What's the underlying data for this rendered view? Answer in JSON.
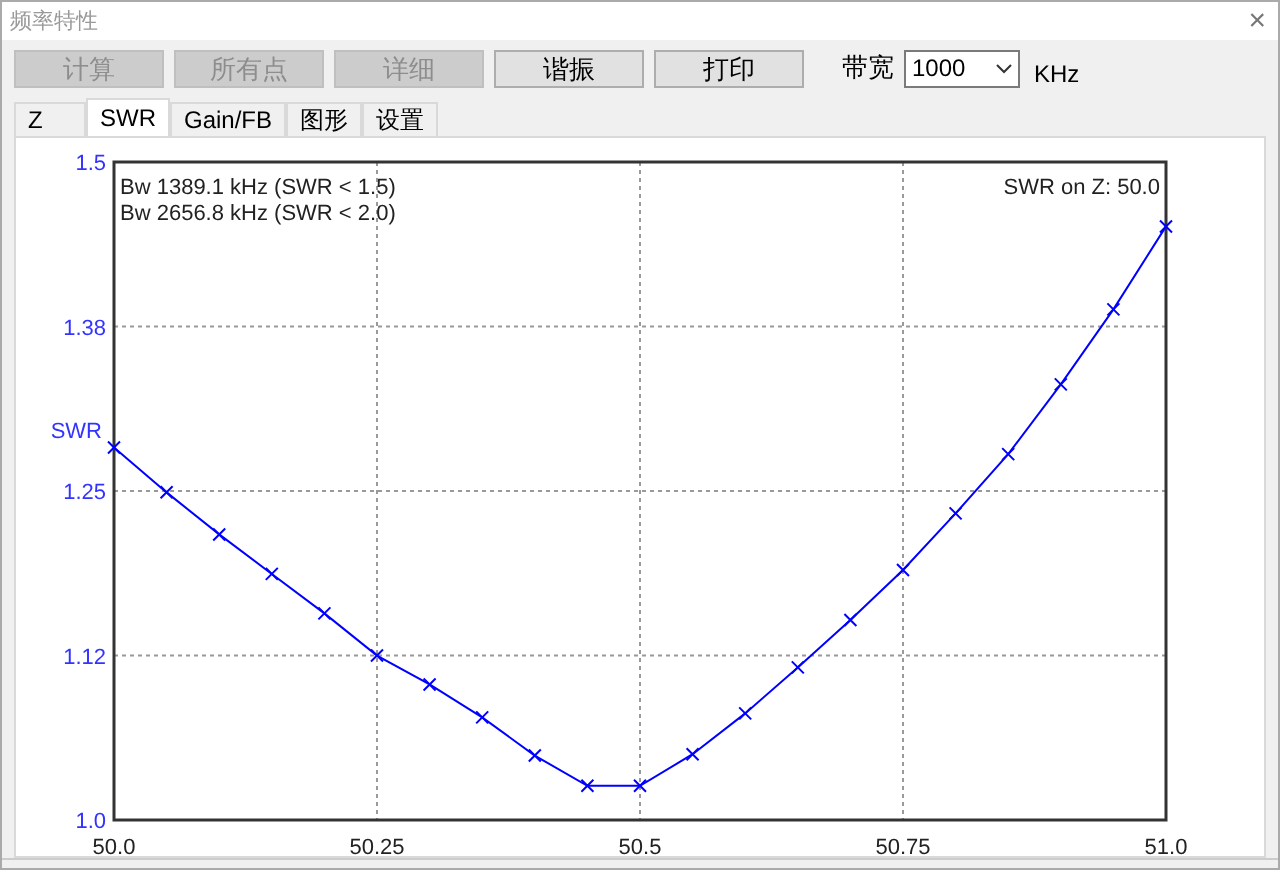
{
  "window": {
    "title": "频率特性",
    "close": "×"
  },
  "toolbar": {
    "buttons": [
      {
        "label": "计算",
        "disabled": true
      },
      {
        "label": "所有点",
        "disabled": true
      },
      {
        "label": "详细",
        "disabled": true
      },
      {
        "label": "谐振",
        "disabled": false
      },
      {
        "label": "打印",
        "disabled": false
      }
    ],
    "bandwidth": {
      "label": "带宽",
      "value": "1000",
      "unit": "KHz"
    }
  },
  "tabs": [
    {
      "label": "Z",
      "selected": false
    },
    {
      "label": "SWR",
      "selected": true
    },
    {
      "label": "Gain/FB",
      "selected": false
    },
    {
      "label": "图形",
      "selected": false
    },
    {
      "label": "设置",
      "selected": false
    }
  ],
  "chart": {
    "bandwidth_notes": [
      "Bw 1389.1 kHz (SWR < 1.5)",
      "Bw 2656.8 kHz (SWR < 2.0)"
    ],
    "z_note": "SWR on Z: 50.0",
    "chart_data": {
      "type": "line",
      "ylabel": "SWR",
      "x": [
        50.0,
        50.05,
        50.1,
        50.15,
        50.2,
        50.25,
        50.3,
        50.35,
        50.4,
        50.45,
        50.5,
        50.55,
        50.6,
        50.65,
        50.7,
        50.75,
        50.8,
        50.85,
        50.9,
        50.95,
        51.0
      ],
      "grid": true,
      "series": [
        {
          "color": "#0000ff",
          "marker": "x",
          "values": [
            1.283,
            1.249,
            1.217,
            1.187,
            1.157,
            1.125,
            1.103,
            1.078,
            1.049,
            1.026,
            1.026,
            1.05,
            1.081,
            1.116,
            1.152,
            1.19,
            1.233,
            1.278,
            1.331,
            1.388,
            1.451
          ]
        }
      ],
      "xlim": [
        50.0,
        51.0
      ],
      "ylim": [
        1.0,
        1.5
      ],
      "xticks": [
        {
          "value": 50.0,
          "label": "50.0"
        },
        {
          "value": 50.25,
          "label": "50.25"
        },
        {
          "value": 50.5,
          "label": "50.5"
        },
        {
          "value": 50.75,
          "label": "50.75"
        },
        {
          "value": 51.0,
          "label": "51.0"
        }
      ],
      "yticks": [
        {
          "value": 1.0,
          "label": "1.0"
        },
        {
          "value": 1.125,
          "label": "1.12"
        },
        {
          "value": 1.25,
          "label": "1.25"
        },
        {
          "value": 1.375,
          "label": "1.38"
        },
        {
          "value": 1.5,
          "label": "1.5"
        }
      ]
    }
  }
}
